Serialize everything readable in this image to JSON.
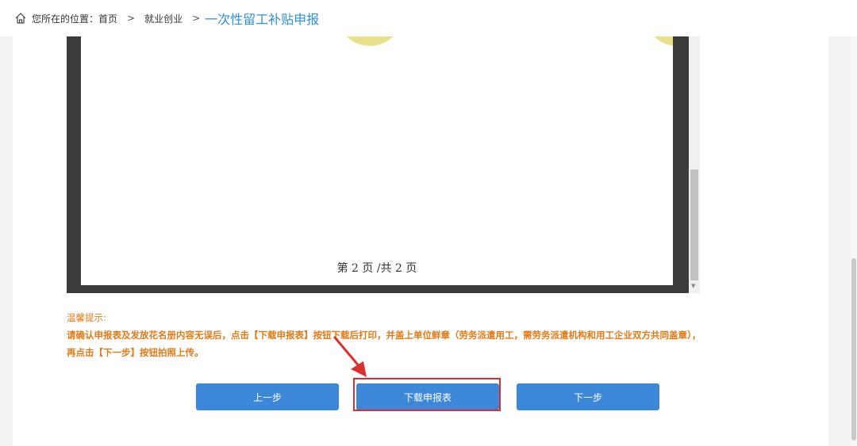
{
  "breadcrumb": {
    "prefix": "您所在的位置：",
    "items": [
      "首页",
      "就业创业"
    ],
    "separator": ">",
    "current": "一次性留工补贴申报"
  },
  "viewer": {
    "page_indicator": "第 2 页 /共 2 页"
  },
  "tips": {
    "title": "温馨提示:",
    "line1": "请确认申报表及发放花名册内容无误后，点击【下载申报表】按钮下载后打印，并盖上单位鲜章（劳务派遣用工，需劳务派遣机构和用工企业双方共同盖章），",
    "line2": "再点击【下一步】按钮拍照上传。"
  },
  "buttons": {
    "prev": "上一步",
    "download": "下载申报表",
    "next": "下一步"
  },
  "colors": {
    "accent": "#3d87d9",
    "tips": "#e07b18",
    "highlight": "#d9302f",
    "current_crumb": "#2f8fd6",
    "watermark": "#e8e08a"
  }
}
